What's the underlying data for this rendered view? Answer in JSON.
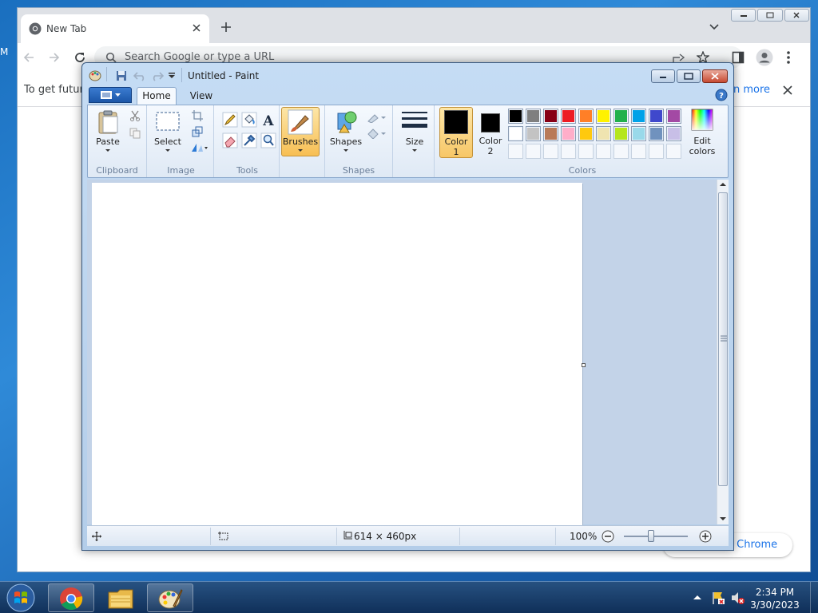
{
  "chrome": {
    "tab_title": "New Tab",
    "omnibox_placeholder": "Search Google or type a URL",
    "infobar_text": "To get future",
    "infobar_link": "n more",
    "customize_label": "e Chrome",
    "desktop_partial": "M"
  },
  "paint": {
    "title": "Untitled - Paint",
    "tabs": {
      "home": "Home",
      "view": "View"
    },
    "groups": {
      "clipboard": "Clipboard",
      "image": "Image",
      "tools": "Tools",
      "shapes": "Shapes",
      "colors": "Colors"
    },
    "buttons": {
      "paste": "Paste",
      "select": "Select",
      "brushes": "Brushes",
      "shapes": "Shapes",
      "size": "Size",
      "color1_line1": "Color",
      "color1_line2": "1",
      "color2_line1": "Color",
      "color2_line2": "2",
      "edit_colors_line1": "Edit",
      "edit_colors_line2": "colors"
    },
    "color1": "#000000",
    "color2": "#000000",
    "palette_row1": [
      "#000000",
      "#7f7f7f",
      "#880015",
      "#ed1c24",
      "#ff7f27",
      "#fff200",
      "#22b14c",
      "#00a2e8",
      "#3f48cc",
      "#a349a4"
    ],
    "palette_row2": [
      "#ffffff",
      "#c3c3c3",
      "#b97a57",
      "#ffaec9",
      "#ffc90e",
      "#efe4b0",
      "#b5e61d",
      "#99d9ea",
      "#7092be",
      "#c8bfe7"
    ],
    "status": {
      "dimensions": "614 × 460px",
      "zoom": "100%"
    }
  },
  "taskbar": {
    "time": "2:34 PM",
    "date": "3/30/2023",
    "items": [
      "start-orb",
      "chrome",
      "file-explorer",
      "paint"
    ]
  }
}
